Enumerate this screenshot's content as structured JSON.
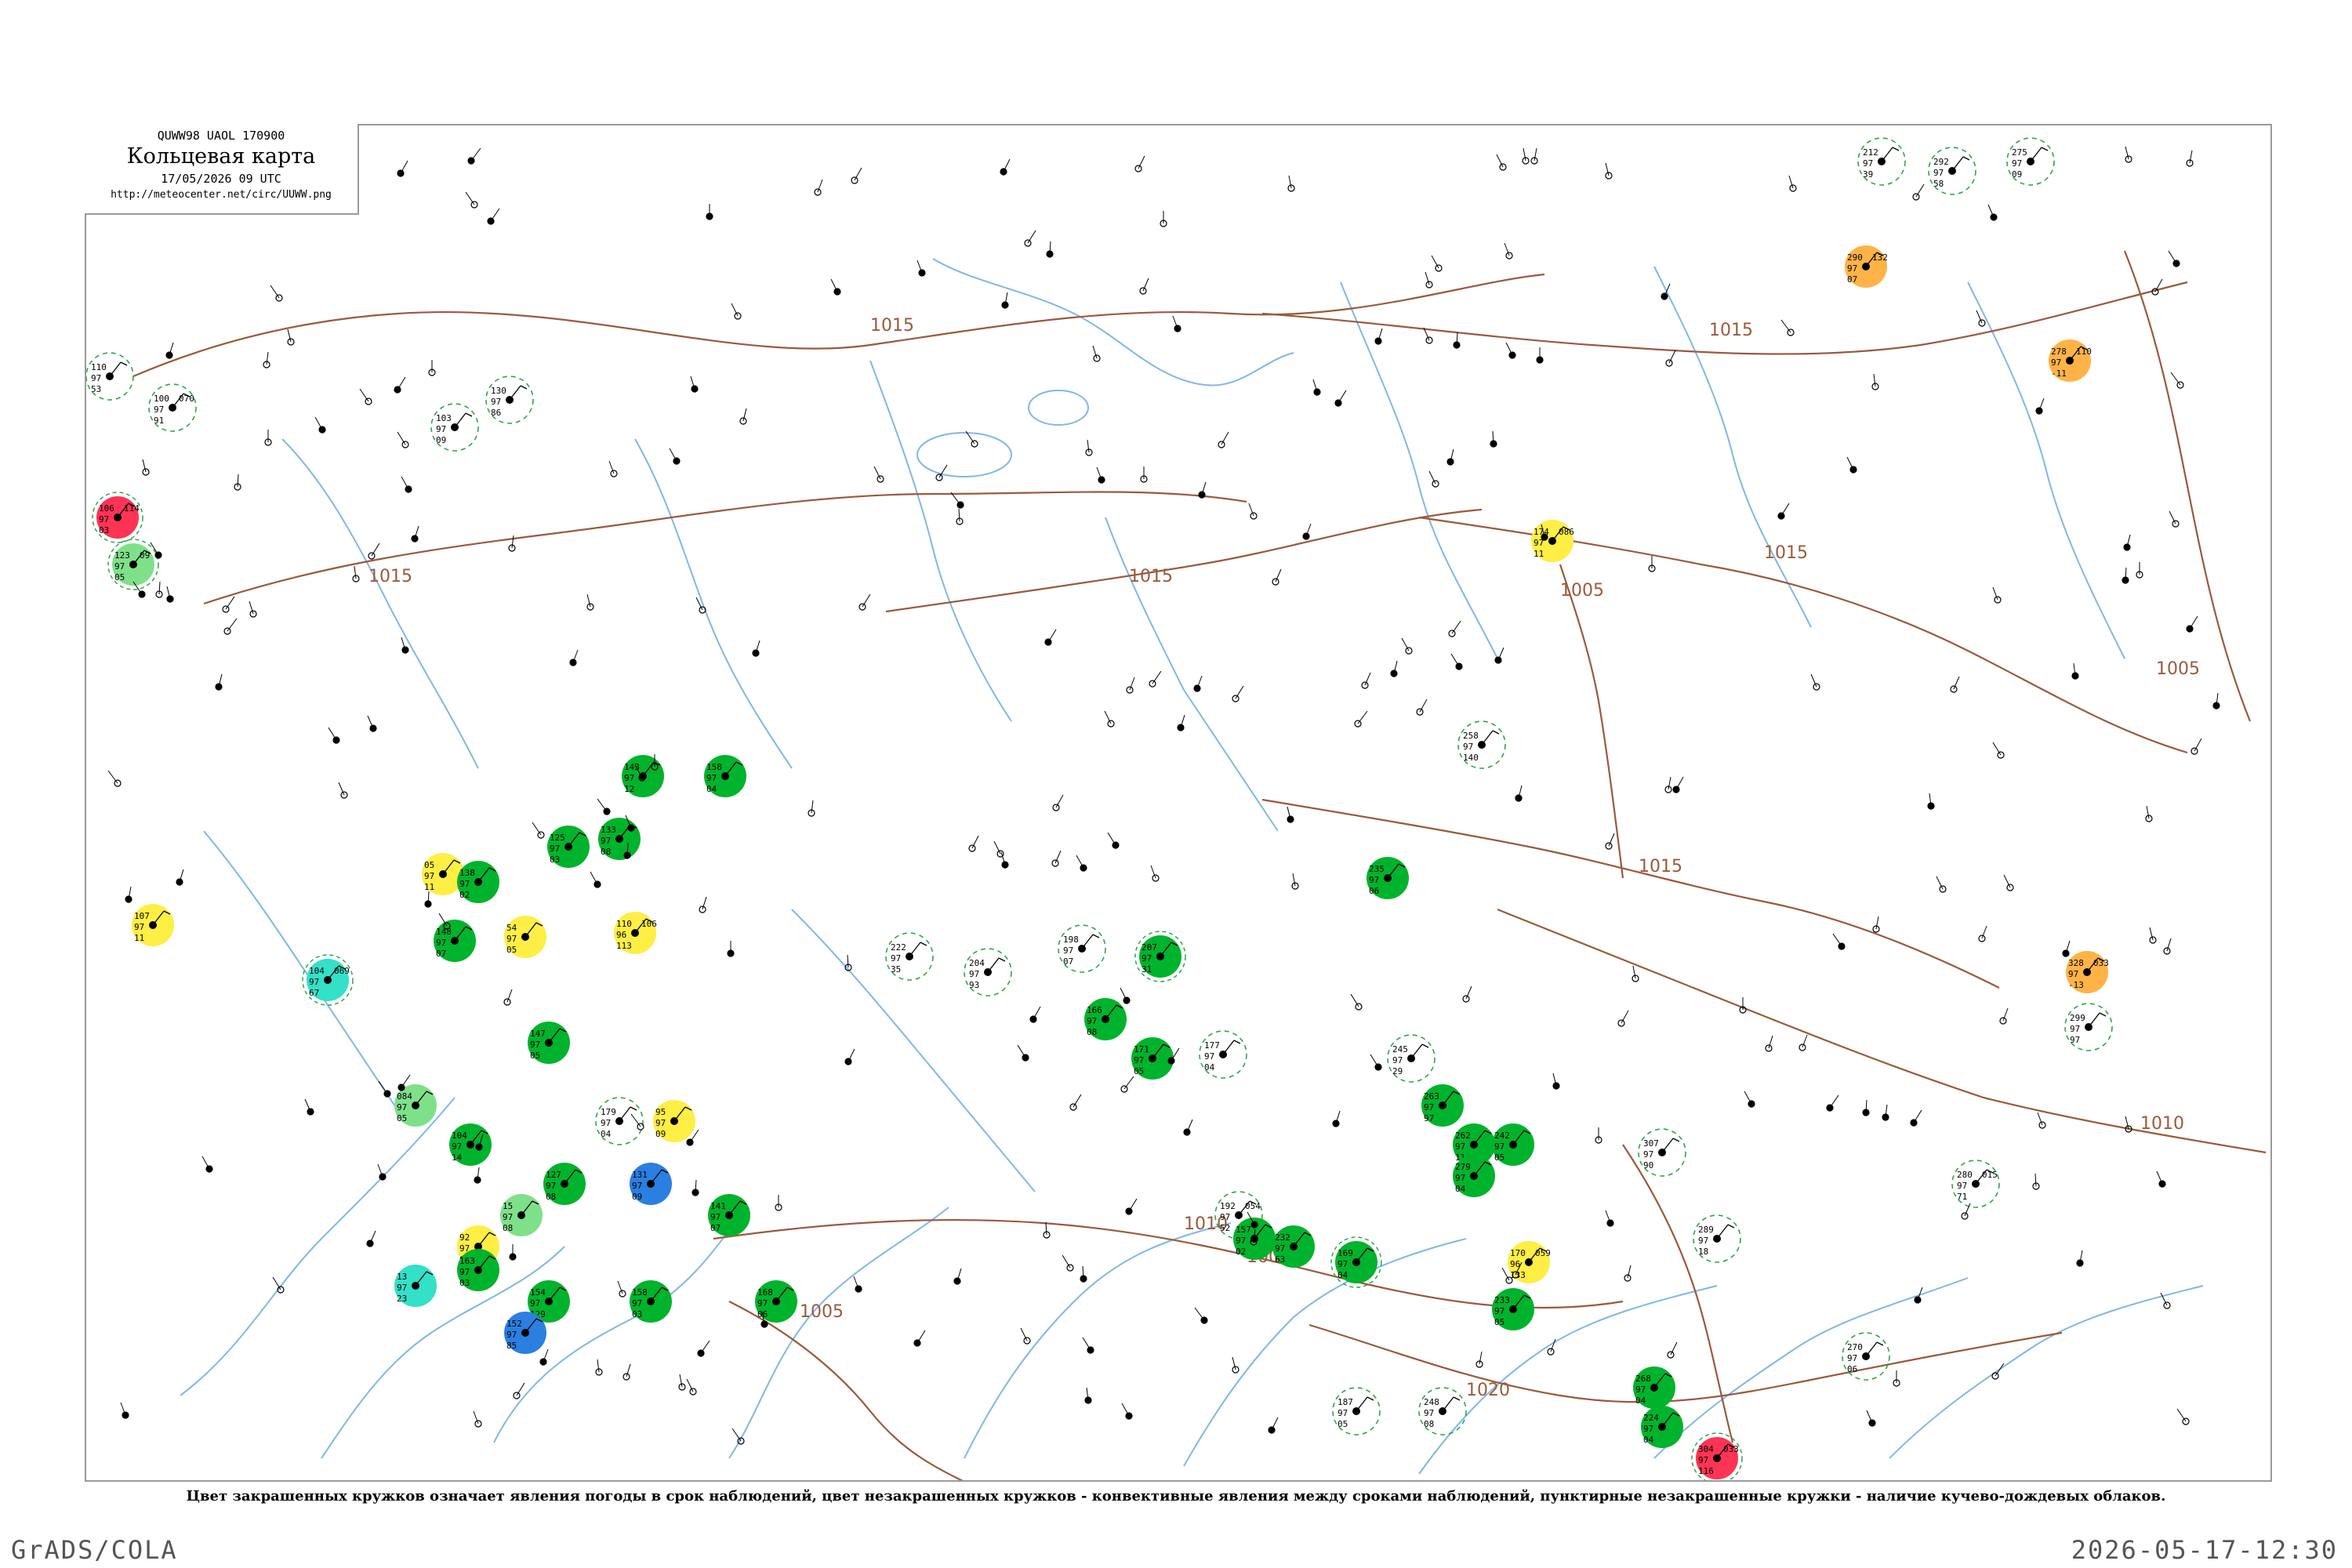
{
  "header": {
    "bulletin_code": "QUWW98  UAOL  170900",
    "title": "Кольцевая карта",
    "date_line": "17/05/2026 09 UTC",
    "url": "http://meteocenter.net/circ/UUWW.png"
  },
  "legend_note": "Цвет закрашенных кружков означает явления погоды в срок наблюдений, цвет незакрашенных кружков - конвективные явления между сроками наблюдений, пунктирные незакрашенные кружки - наличие кучево-дождевых облаков.",
  "footer": {
    "left": "GrADS/COLA",
    "right": "2026-05-17-12:30"
  },
  "colors": {
    "isobar": "#9b5a3a",
    "river": "#7fb8e8",
    "rain": "#00b32c",
    "drizzle": "#7fe08a",
    "thunder": "#ff3355",
    "fog": "#ffee44",
    "haze": "#ffb347",
    "shower_snow": "#2a7fe0",
    "mist": "#33e0c8",
    "cb_dashed": "#2ba84a"
  },
  "isobar_labels": [
    "1015",
    "1015",
    "1015",
    "1015",
    "1015",
    "1015",
    "1010",
    "1010",
    "1005",
    "1005",
    "1005",
    "1005",
    "1020"
  ],
  "stations": [
    {
      "id": "s1",
      "p": "110",
      "t": "97",
      "d": "53",
      "fill": "none",
      "cb": false
    },
    {
      "id": "s2",
      "p": "100",
      "t": "97",
      "d": "91",
      "v": "070",
      "fill": "none",
      "cb": true
    },
    {
      "id": "s3",
      "p": "106",
      "t": "97",
      "d": "03",
      "v": "114",
      "fill": "thunder",
      "cb": true
    },
    {
      "id": "s4",
      "p": "123",
      "t": "97",
      "d": "05",
      "v": "09",
      "fill": "drizzle",
      "cb": true
    },
    {
      "id": "s5",
      "p": "107",
      "t": "97",
      "d": "11",
      "fill": "fog",
      "cb": false
    },
    {
      "id": "s6",
      "p": "104",
      "t": "97",
      "d": "67",
      "v": "069",
      "fill": "mist",
      "cb": true
    },
    {
      "id": "s7",
      "p": "103",
      "t": "97",
      "d": "09",
      "fill": "none",
      "cb": true
    },
    {
      "id": "s8",
      "p": "130",
      "t": "97",
      "d": "86",
      "fill": "none",
      "cb": true
    },
    {
      "id": "s9",
      "p": "143",
      "t": "97",
      "d": "12",
      "fill": "rain",
      "cb": false
    },
    {
      "id": "s10",
      "p": "158",
      "t": "97",
      "d": "04",
      "fill": "rain",
      "cb": false
    },
    {
      "id": "s11",
      "p": "125",
      "t": "97",
      "d": "03",
      "fill": "rain",
      "cb": false
    },
    {
      "id": "s12",
      "p": "133",
      "t": "97",
      "d": "08",
      "fill": "rain",
      "cb": false
    },
    {
      "id": "s13",
      "p": "05",
      "t": "97",
      "d": "11",
      "fill": "fog",
      "cb": false
    },
    {
      "id": "s14",
      "p": "138",
      "t": "97",
      "d": "02",
      "fill": "rain",
      "cb": false
    },
    {
      "id": "s15",
      "p": "54",
      "t": "97",
      "d": "05",
      "fill": "fog",
      "cb": false
    },
    {
      "id": "s16",
      "p": "110",
      "t": "96",
      "d": "113",
      "v": "106",
      "fill": "fog",
      "cb": false
    },
    {
      "id": "s17",
      "p": "148",
      "t": "97",
      "d": "07",
      "fill": "rain",
      "cb": false
    },
    {
      "id": "s18",
      "p": "084",
      "t": "97",
      "d": "05",
      "fill": "drizzle",
      "cb": false
    },
    {
      "id": "s19",
      "p": "104",
      "t": "97",
      "d": "14",
      "fill": "rain",
      "cb": false
    },
    {
      "id": "s20",
      "p": "127",
      "t": "97",
      "d": "08",
      "fill": "rain",
      "cb": false
    },
    {
      "id": "s21",
      "p": "15",
      "t": "97",
      "d": "08",
      "fill": "drizzle",
      "cb": false
    },
    {
      "id": "s22",
      "p": "92",
      "t": "97",
      "d": "61",
      "fill": "fog",
      "cb": false
    },
    {
      "id": "s23",
      "p": "13",
      "t": "97",
      "d": "23",
      "fill": "mist",
      "cb": false
    },
    {
      "id": "s24",
      "p": "163",
      "t": "97",
      "d": "03",
      "fill": "rain",
      "cb": false
    },
    {
      "id": "s25",
      "p": "154",
      "t": "97",
      "d": "129",
      "fill": "rain",
      "cb": false
    },
    {
      "id": "s26",
      "p": "152",
      "t": "97",
      "d": "85",
      "fill": "shower_snow",
      "cb": false
    },
    {
      "id": "s27",
      "p": "179",
      "t": "97",
      "d": "04",
      "fill": "none",
      "cb": true
    },
    {
      "id": "s28",
      "p": "95",
      "t": "97",
      "d": "09",
      "fill": "fog",
      "cb": false
    },
    {
      "id": "s29",
      "p": "131",
      "t": "97",
      "d": "09",
      "fill": "shower_snow",
      "cb": false
    },
    {
      "id": "s30",
      "p": "141",
      "t": "97",
      "d": "07",
      "fill": "rain",
      "cb": false
    },
    {
      "id": "s31",
      "p": "158",
      "t": "97",
      "d": "03",
      "fill": "rain",
      "cb": false
    },
    {
      "id": "s32",
      "p": "168",
      "t": "97",
      "d": "06",
      "fill": "rain",
      "cb": false
    },
    {
      "id": "s33",
      "p": "147",
      "t": "97",
      "d": "05",
      "fill": "rain",
      "cb": false
    },
    {
      "id": "s34",
      "p": "222",
      "t": "97",
      "d": "35",
      "fill": "none",
      "cb": true
    },
    {
      "id": "s35",
      "p": "204",
      "t": "97",
      "d": "93",
      "fill": "none",
      "cb": true
    },
    {
      "id": "s36",
      "p": "198",
      "t": "97",
      "d": "07",
      "fill": "none",
      "cb": true
    },
    {
      "id": "s37",
      "p": "207",
      "t": "97",
      "d": "31",
      "fill": "rain",
      "cb": true
    },
    {
      "id": "s38",
      "p": "166",
      "t": "97",
      "d": "08",
      "fill": "rain",
      "cb": false
    },
    {
      "id": "s39",
      "p": "171",
      "t": "97",
      "d": "05",
      "fill": "rain",
      "cb": false
    },
    {
      "id": "s40",
      "p": "177",
      "t": "97",
      "d": "04",
      "fill": "none",
      "cb": true
    },
    {
      "id": "s41",
      "p": "192",
      "t": "97",
      "d": "52",
      "v": "054",
      "fill": "none",
      "cb": true
    },
    {
      "id": "s42",
      "p": "157",
      "t": "97",
      "d": "02",
      "fill": "rain",
      "cb": false
    },
    {
      "id": "s43",
      "p": "169",
      "t": "97",
      "d": "04",
      "fill": "rain",
      "cb": true
    },
    {
      "id": "s44",
      "p": "232",
      "t": "97",
      "d": "63",
      "fill": "rain",
      "cb": false
    },
    {
      "id": "s45",
      "p": "187",
      "t": "97",
      "d": "05",
      "fill": "none",
      "cb": true
    },
    {
      "id": "s46",
      "p": "248",
      "t": "97",
      "d": "08",
      "fill": "none",
      "cb": true
    },
    {
      "id": "s47",
      "p": "245",
      "t": "97",
      "d": "29",
      "fill": "none",
      "cb": true
    },
    {
      "id": "s48",
      "p": "263",
      "t": "97",
      "d": "97",
      "fill": "rain",
      "cb": false
    },
    {
      "id": "s49",
      "p": "262",
      "t": "97",
      "d": "11",
      "fill": "rain",
      "cb": false
    },
    {
      "id": "s50",
      "p": "258",
      "t": "97",
      "d": "140",
      "fill": "none",
      "cb": true
    },
    {
      "id": "s51",
      "p": "174",
      "t": "97",
      "d": "11",
      "v": "086",
      "fill": "fog",
      "cb": false
    },
    {
      "id": "s52",
      "p": "170",
      "t": "96",
      "d": "133",
      "v": "059",
      "fill": "fog",
      "cb": false
    },
    {
      "id": "s53",
      "p": "233",
      "t": "97",
      "d": "05",
      "fill": "rain",
      "cb": false
    },
    {
      "id": "s54",
      "p": "235",
      "t": "97",
      "d": "06",
      "fill": "rain",
      "cb": false
    },
    {
      "id": "s55",
      "p": "242",
      "t": "97",
      "d": "05",
      "fill": "rain",
      "cb": false
    },
    {
      "id": "s56",
      "p": "279",
      "t": "97",
      "d": "04",
      "fill": "rain",
      "cb": false
    },
    {
      "id": "s57",
      "p": "268",
      "t": "97",
      "d": "04",
      "fill": "rain",
      "cb": false
    },
    {
      "id": "s58",
      "p": "224",
      "t": "97",
      "d": "04",
      "fill": "rain",
      "cb": false
    },
    {
      "id": "s59",
      "p": "304",
      "t": "97",
      "d": "116",
      "v": "033",
      "fill": "thunder",
      "cb": true
    },
    {
      "id": "s60",
      "p": "270",
      "t": "97",
      "d": "06",
      "fill": "none",
      "cb": true
    },
    {
      "id": "s61",
      "p": "212",
      "t": "97",
      "d": "39",
      "fill": "none",
      "cb": true
    },
    {
      "id": "s62",
      "p": "292",
      "t": "97",
      "d": "58",
      "fill": "none",
      "cb": true
    },
    {
      "id": "s63",
      "p": "275",
      "t": "97",
      "d": "09",
      "fill": "none",
      "cb": true
    },
    {
      "id": "s64",
      "p": "290",
      "t": "97",
      "d": "07",
      "v": "132",
      "fill": "haze",
      "cb": false
    },
    {
      "id": "s65",
      "p": "278",
      "t": "97",
      "d": "-11",
      "v": "110",
      "fill": "haze",
      "cb": false
    },
    {
      "id": "s66",
      "p": "328",
      "t": "97",
      "d": "-13",
      "v": "033",
      "fill": "haze",
      "cb": false
    },
    {
      "id": "s67",
      "p": "299",
      "t": "97",
      "d": "97",
      "fill": "none",
      "cb": true
    },
    {
      "id": "s68",
      "p": "280",
      "t": "97",
      "d": "71",
      "v": "015",
      "fill": "none",
      "cb": true
    },
    {
      "id": "s69",
      "p": "307",
      "t": "97",
      "d": "90",
      "fill": "none",
      "cb": true
    },
    {
      "id": "s70",
      "p": "289",
      "t": "97",
      "d": "18",
      "fill": "none",
      "cb": true
    }
  ]
}
